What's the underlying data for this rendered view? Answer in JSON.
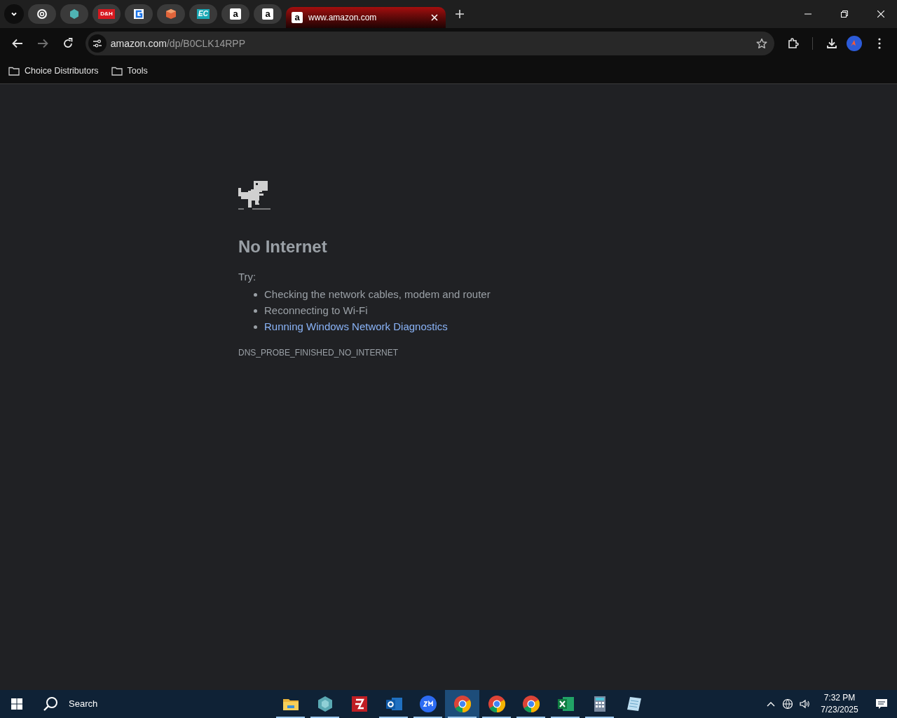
{
  "tab_strip": {
    "tabs": [
      {
        "kind": "swirl",
        "selected": false
      },
      {
        "kind": "hexagon",
        "selected": false
      },
      {
        "kind": "badge",
        "icon_text": "D&H",
        "selected": false
      },
      {
        "kind": "g-logo",
        "selected": false
      },
      {
        "kind": "cube",
        "selected": false
      },
      {
        "kind": "badge-teal",
        "icon_text": "EC",
        "selected": false
      },
      {
        "kind": "amazon",
        "icon_text": "a",
        "selected": false
      },
      {
        "kind": "amazon",
        "icon_text": "a",
        "selected": false
      },
      {
        "kind": "amazon",
        "icon_text": "a",
        "title": "www.amazon.com",
        "selected": true
      }
    ]
  },
  "toolbar": {
    "url_host": "amazon.com",
    "url_path": "/dp/B0CLK14RPP"
  },
  "bookmarks": [
    {
      "label": "Choice Distributors"
    },
    {
      "label": "Tools"
    }
  ],
  "error_page": {
    "title": "No Internet",
    "try_label": "Try:",
    "suggestions": [
      {
        "text": "Checking the network cables, modem and router",
        "kind": "text"
      },
      {
        "text": "Reconnecting to Wi-Fi",
        "kind": "text"
      },
      {
        "text": "Running Windows Network Diagnostics",
        "kind": "link"
      }
    ],
    "error_code": "DNS_PROBE_FINISHED_NO_INTERNET"
  },
  "taskbar": {
    "search_label": "Search",
    "apps": [
      {
        "kind": "folder",
        "running": true,
        "selected": false
      },
      {
        "kind": "hexagon",
        "running": true,
        "selected": false
      },
      {
        "kind": "filezilla",
        "running": false,
        "selected": false
      },
      {
        "kind": "outlook",
        "running": true,
        "selected": false
      },
      {
        "kind": "zoom",
        "running": true,
        "selected": false
      },
      {
        "kind": "chrome",
        "running": true,
        "selected": true
      },
      {
        "kind": "chrome",
        "running": true,
        "selected": false
      },
      {
        "kind": "chrome",
        "running": true,
        "selected": false
      },
      {
        "kind": "excel",
        "running": true,
        "selected": false
      },
      {
        "kind": "calculator",
        "running": true,
        "selected": false
      },
      {
        "kind": "notepad",
        "running": false,
        "selected": false
      }
    ],
    "time": "7:32 PM",
    "date": "7/23/2025"
  }
}
